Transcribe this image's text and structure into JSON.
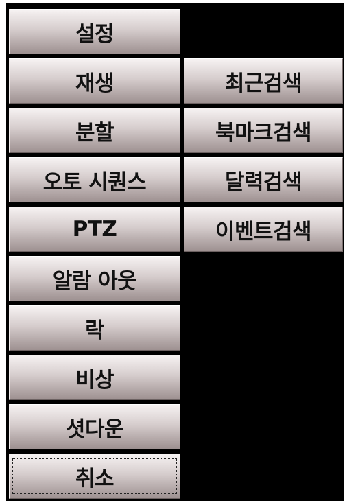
{
  "menu": {
    "left_items": [
      {
        "label": "설정"
      },
      {
        "label": "재생"
      },
      {
        "label": "분할"
      },
      {
        "label": "오토 시퀀스"
      },
      {
        "label": "PTZ"
      },
      {
        "label": "알람 아웃"
      },
      {
        "label": "락"
      },
      {
        "label": "비상"
      },
      {
        "label": "셧다운"
      },
      {
        "label": "취소"
      }
    ],
    "right_items": [
      {
        "label": "최근검색"
      },
      {
        "label": "북마크검색"
      },
      {
        "label": "달력검색"
      },
      {
        "label": "이벤트검색"
      }
    ],
    "focused_item": "취소"
  }
}
